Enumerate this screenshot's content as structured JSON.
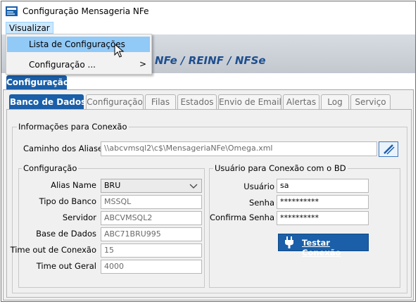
{
  "window": {
    "title": "Configuração Mensageria NFe"
  },
  "menubar": {
    "visualizar": "Visualizar"
  },
  "dropdown": {
    "items": [
      {
        "label": "Lista de Configurações"
      },
      {
        "label": "Configuração ...",
        "submenu_arrow": ">"
      }
    ]
  },
  "header": {
    "title": "NFe / REINF / NFSe"
  },
  "outer_tab": {
    "label": "Configuração"
  },
  "tabs": [
    {
      "label": "Banco de Dados",
      "active": true
    },
    {
      "label": "Configuração"
    },
    {
      "label": "Filas"
    },
    {
      "label": "Estados"
    },
    {
      "label": "Envio de Email"
    },
    {
      "label": "Alertas"
    },
    {
      "label": "Log"
    },
    {
      "label": "Serviço"
    }
  ],
  "connection": {
    "legend": "Informações para Conexão",
    "path_label": "Caminho dos Aliases",
    "path_value": "\\\\abcvmsql2\\c$\\MensageriaNFe\\Omega.xml"
  },
  "config": {
    "legend": "Configuração",
    "alias_label": "Alias Name",
    "alias_value": "BRU",
    "tipo_label": "Tipo do Banco",
    "tipo_value": "MSSQL",
    "servidor_label": "Servidor",
    "servidor_value": "ABCVMSQL2",
    "base_label": "Base de Dados",
    "base_value": "ABC71BRU995",
    "timeout_conn_label": "Time out de Conexão",
    "timeout_conn_value": "15",
    "timeout_geral_label": "Time out Geral",
    "timeout_geral_value": "4000"
  },
  "user": {
    "legend": "Usuário para Conexão com o BD",
    "usuario_label": "Usuário",
    "usuario_value": "sa",
    "senha_label": "Senha",
    "senha_value": "**********",
    "confirma_label": "Confirma Senha",
    "confirma_value": "**********",
    "test_button": "Testar Conexão"
  },
  "icons": {
    "app": "nfe-app-icon",
    "cursor": "mouse-pointer-icon",
    "dropdown_arrow": "chevron-down-icon",
    "folder_button": "edit-path-icon",
    "plug": "plug-icon"
  },
  "colors": {
    "accent": "#1a5fa8",
    "menu_highlight": "#91c9f7",
    "header_text": "#1f4f8f"
  }
}
